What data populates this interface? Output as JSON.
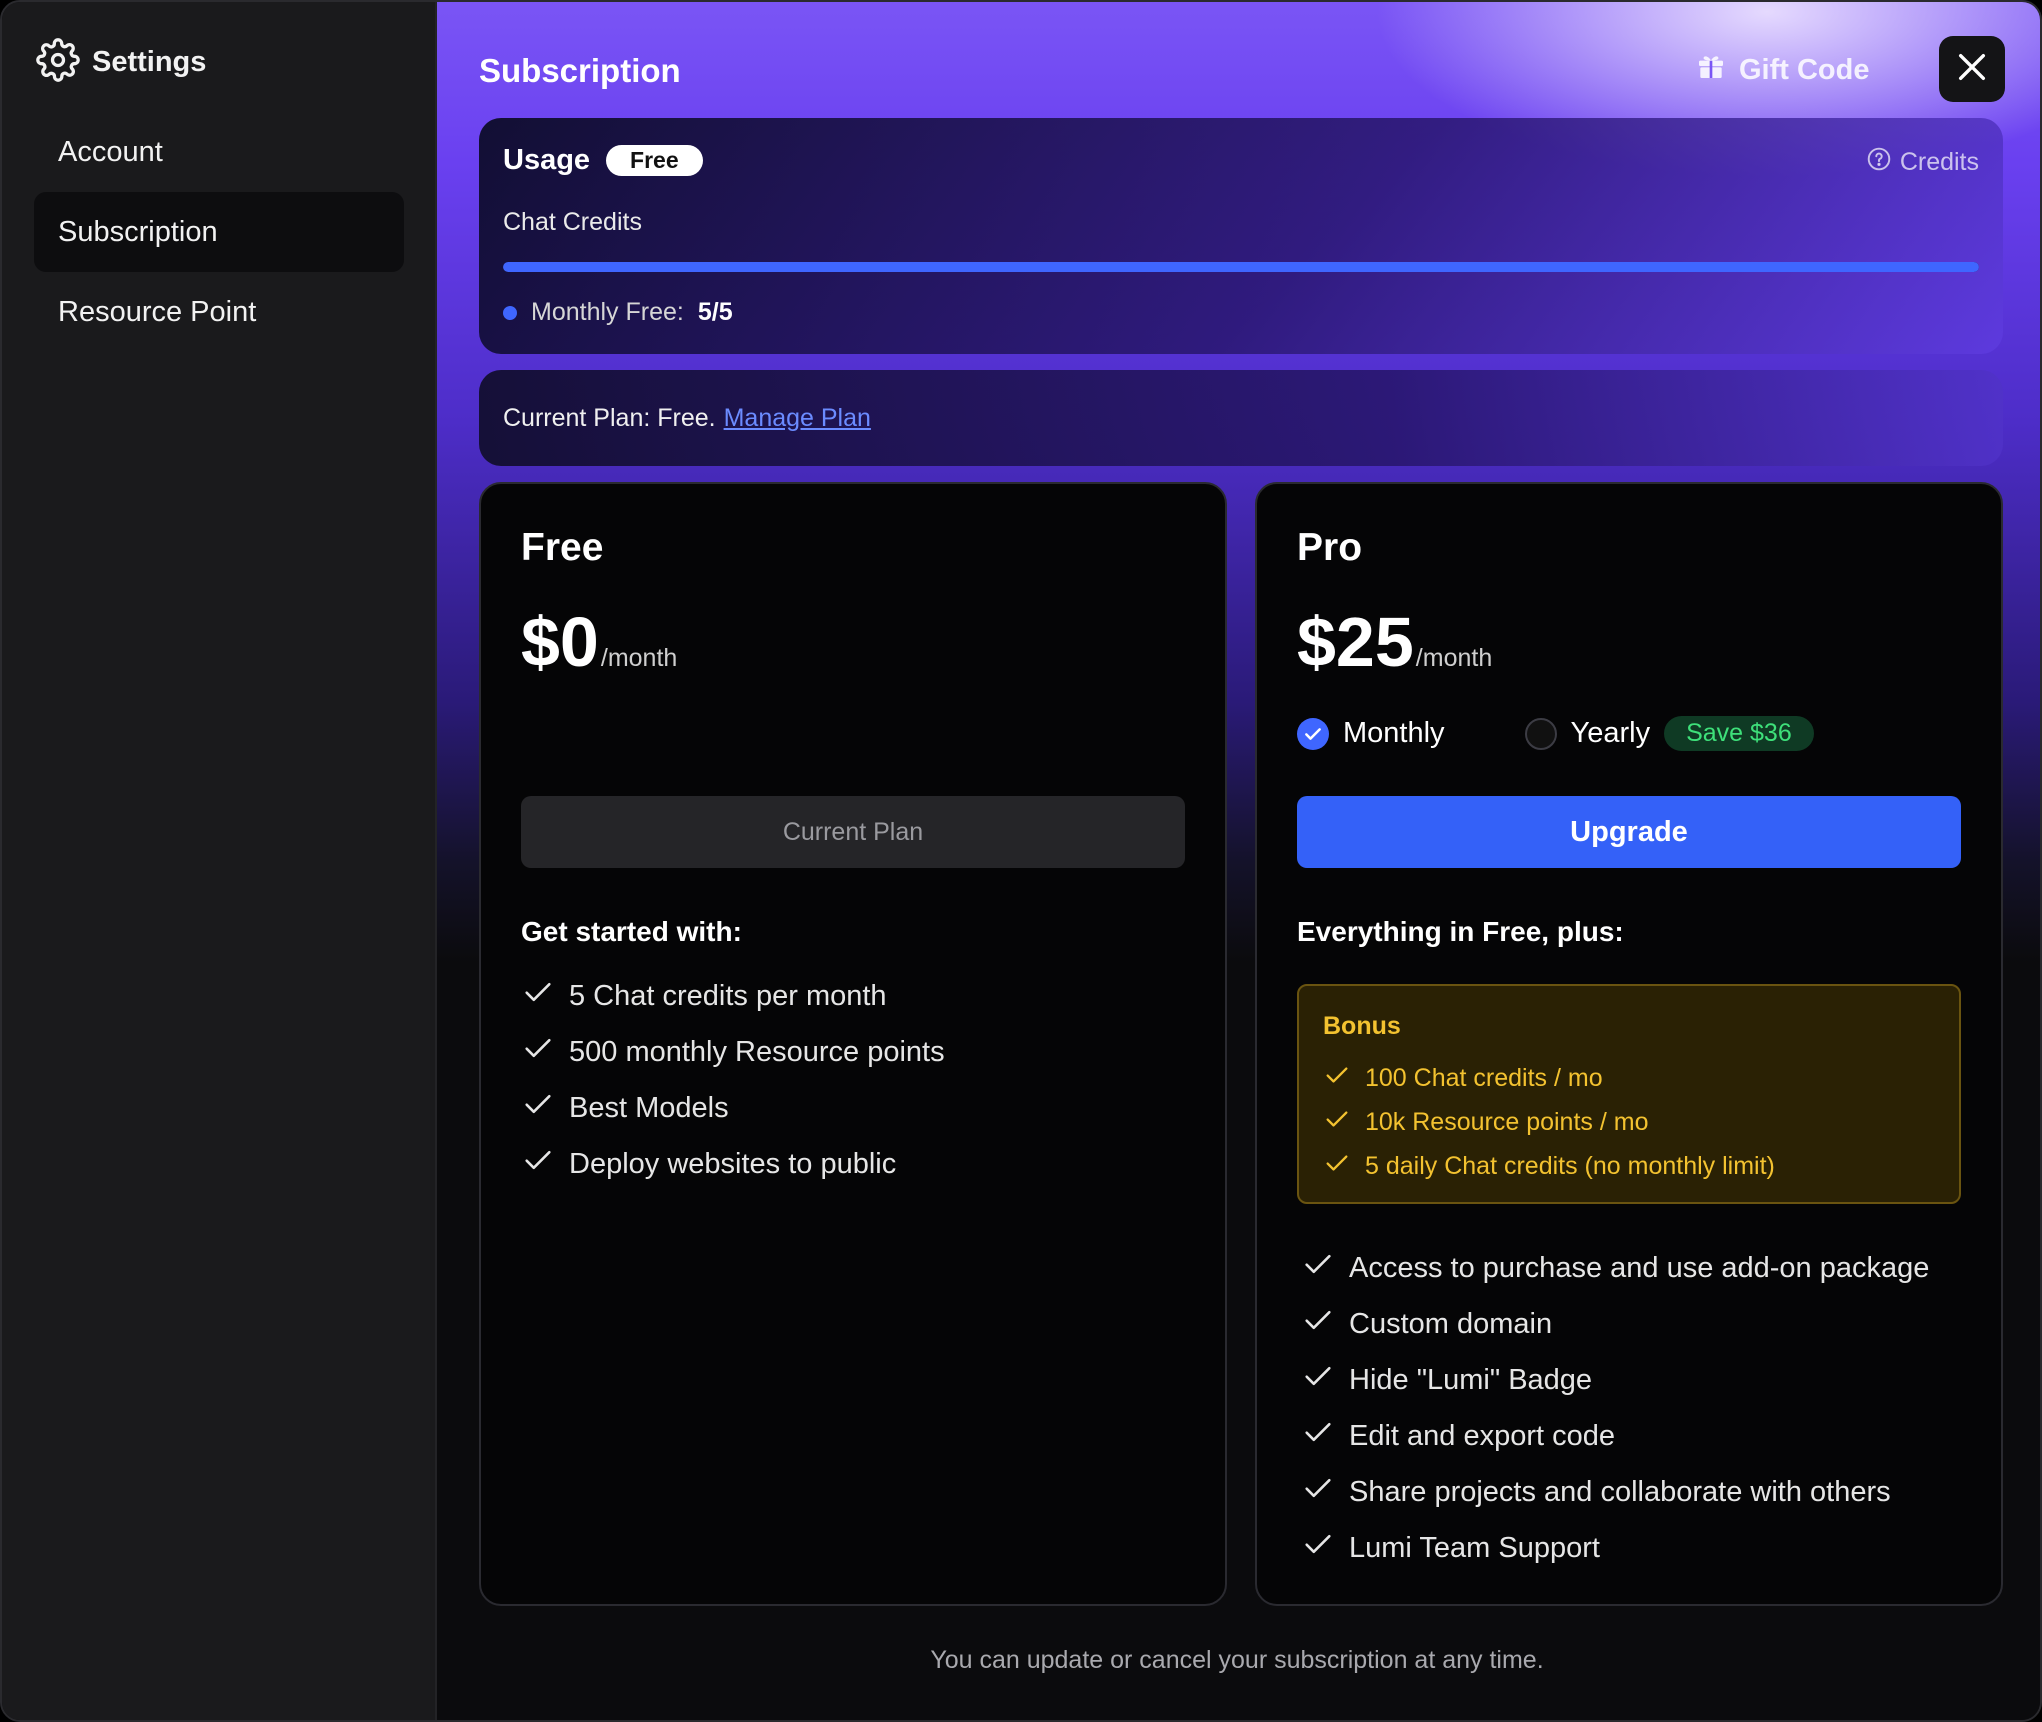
{
  "sidebar": {
    "title": "Settings",
    "items": [
      {
        "label": "Account",
        "active": false
      },
      {
        "label": "Subscription",
        "active": true
      },
      {
        "label": "Resource Point",
        "active": false
      }
    ]
  },
  "header": {
    "title": "Subscription",
    "gift_label": "Gift Code"
  },
  "usage": {
    "title": "Usage",
    "plan_badge": "Free",
    "credits_link": "Credits",
    "chat_credits_label": "Chat Credits",
    "progress_fraction": 1.0,
    "monthly_free_label": "Monthly Free:",
    "monthly_free_value": "5/5"
  },
  "current_plan": {
    "text": "Current Plan: Free.",
    "link": "Manage Plan"
  },
  "plans": {
    "free": {
      "name": "Free",
      "price": "$0",
      "period": "/month",
      "button": "Current Plan",
      "features_title": "Get started with:",
      "features": [
        "5 Chat credits per month",
        "500 monthly Resource points",
        "Best Models",
        "Deploy websites to public"
      ]
    },
    "pro": {
      "name": "Pro",
      "price": "$25",
      "period": "/month",
      "billing": {
        "monthly": "Monthly",
        "yearly": "Yearly",
        "save_badge": "Save $36",
        "selected": "monthly"
      },
      "button": "Upgrade",
      "features_title": "Everything in Free, plus:",
      "bonus": {
        "title": "Bonus",
        "items": [
          "100 Chat credits / mo",
          "10k Resource points / mo",
          "5 daily Chat credits (no monthly limit)"
        ]
      },
      "features": [
        "Access to purchase and use add-on package",
        "Custom domain",
        "Hide \"Lumi\" Badge",
        "Edit and export code",
        "Share projects and collaborate with others",
        "Lumi Team Support"
      ]
    }
  },
  "footer_note": "You can update or cancel your subscription at any time.",
  "colors": {
    "accent": "#3f66ff",
    "upgrade_button": "#3461f8",
    "bonus_text": "#f3c230",
    "save_badge_text": "#3ee07a"
  }
}
